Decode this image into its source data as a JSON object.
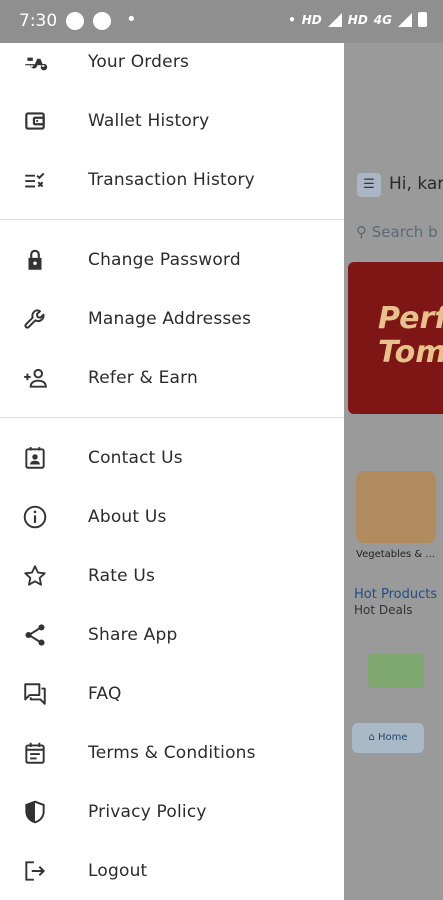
{
  "status_bar": {
    "time": "7:30",
    "right": [
      "HD",
      "HD",
      "4G"
    ]
  },
  "drawer": {
    "group1": [
      {
        "label": "Your Orders",
        "icon": "scooter-icon"
      },
      {
        "label": "Wallet History",
        "icon": "wallet-icon"
      },
      {
        "label": "Transaction History",
        "icon": "transaction-list-icon"
      }
    ],
    "group2": [
      {
        "label": "Change Password",
        "icon": "lock-icon"
      },
      {
        "label": "Manage Addresses",
        "icon": "wrench-icon"
      },
      {
        "label": "Refer & Earn",
        "icon": "person-add-icon"
      }
    ],
    "group3": [
      {
        "label": "Contact Us",
        "icon": "contact-card-icon"
      },
      {
        "label": "About Us",
        "icon": "info-icon"
      },
      {
        "label": "Rate Us",
        "icon": "star-icon"
      },
      {
        "label": "Share App",
        "icon": "share-icon"
      },
      {
        "label": "FAQ",
        "icon": "forum-icon"
      },
      {
        "label": "Terms & Conditions",
        "icon": "calendar-icon"
      },
      {
        "label": "Privacy Policy",
        "icon": "shield-icon"
      },
      {
        "label": "Logout",
        "icon": "logout-icon"
      }
    ]
  },
  "background_app": {
    "greeting": "Hi, kar",
    "search_placeholder": "Search b",
    "banner_text": "Perfe Tomato",
    "category_label": "Vegetables & ...",
    "section_title": "Hot Products",
    "section_subtitle": "Hot Deals",
    "home_button": "Home"
  }
}
